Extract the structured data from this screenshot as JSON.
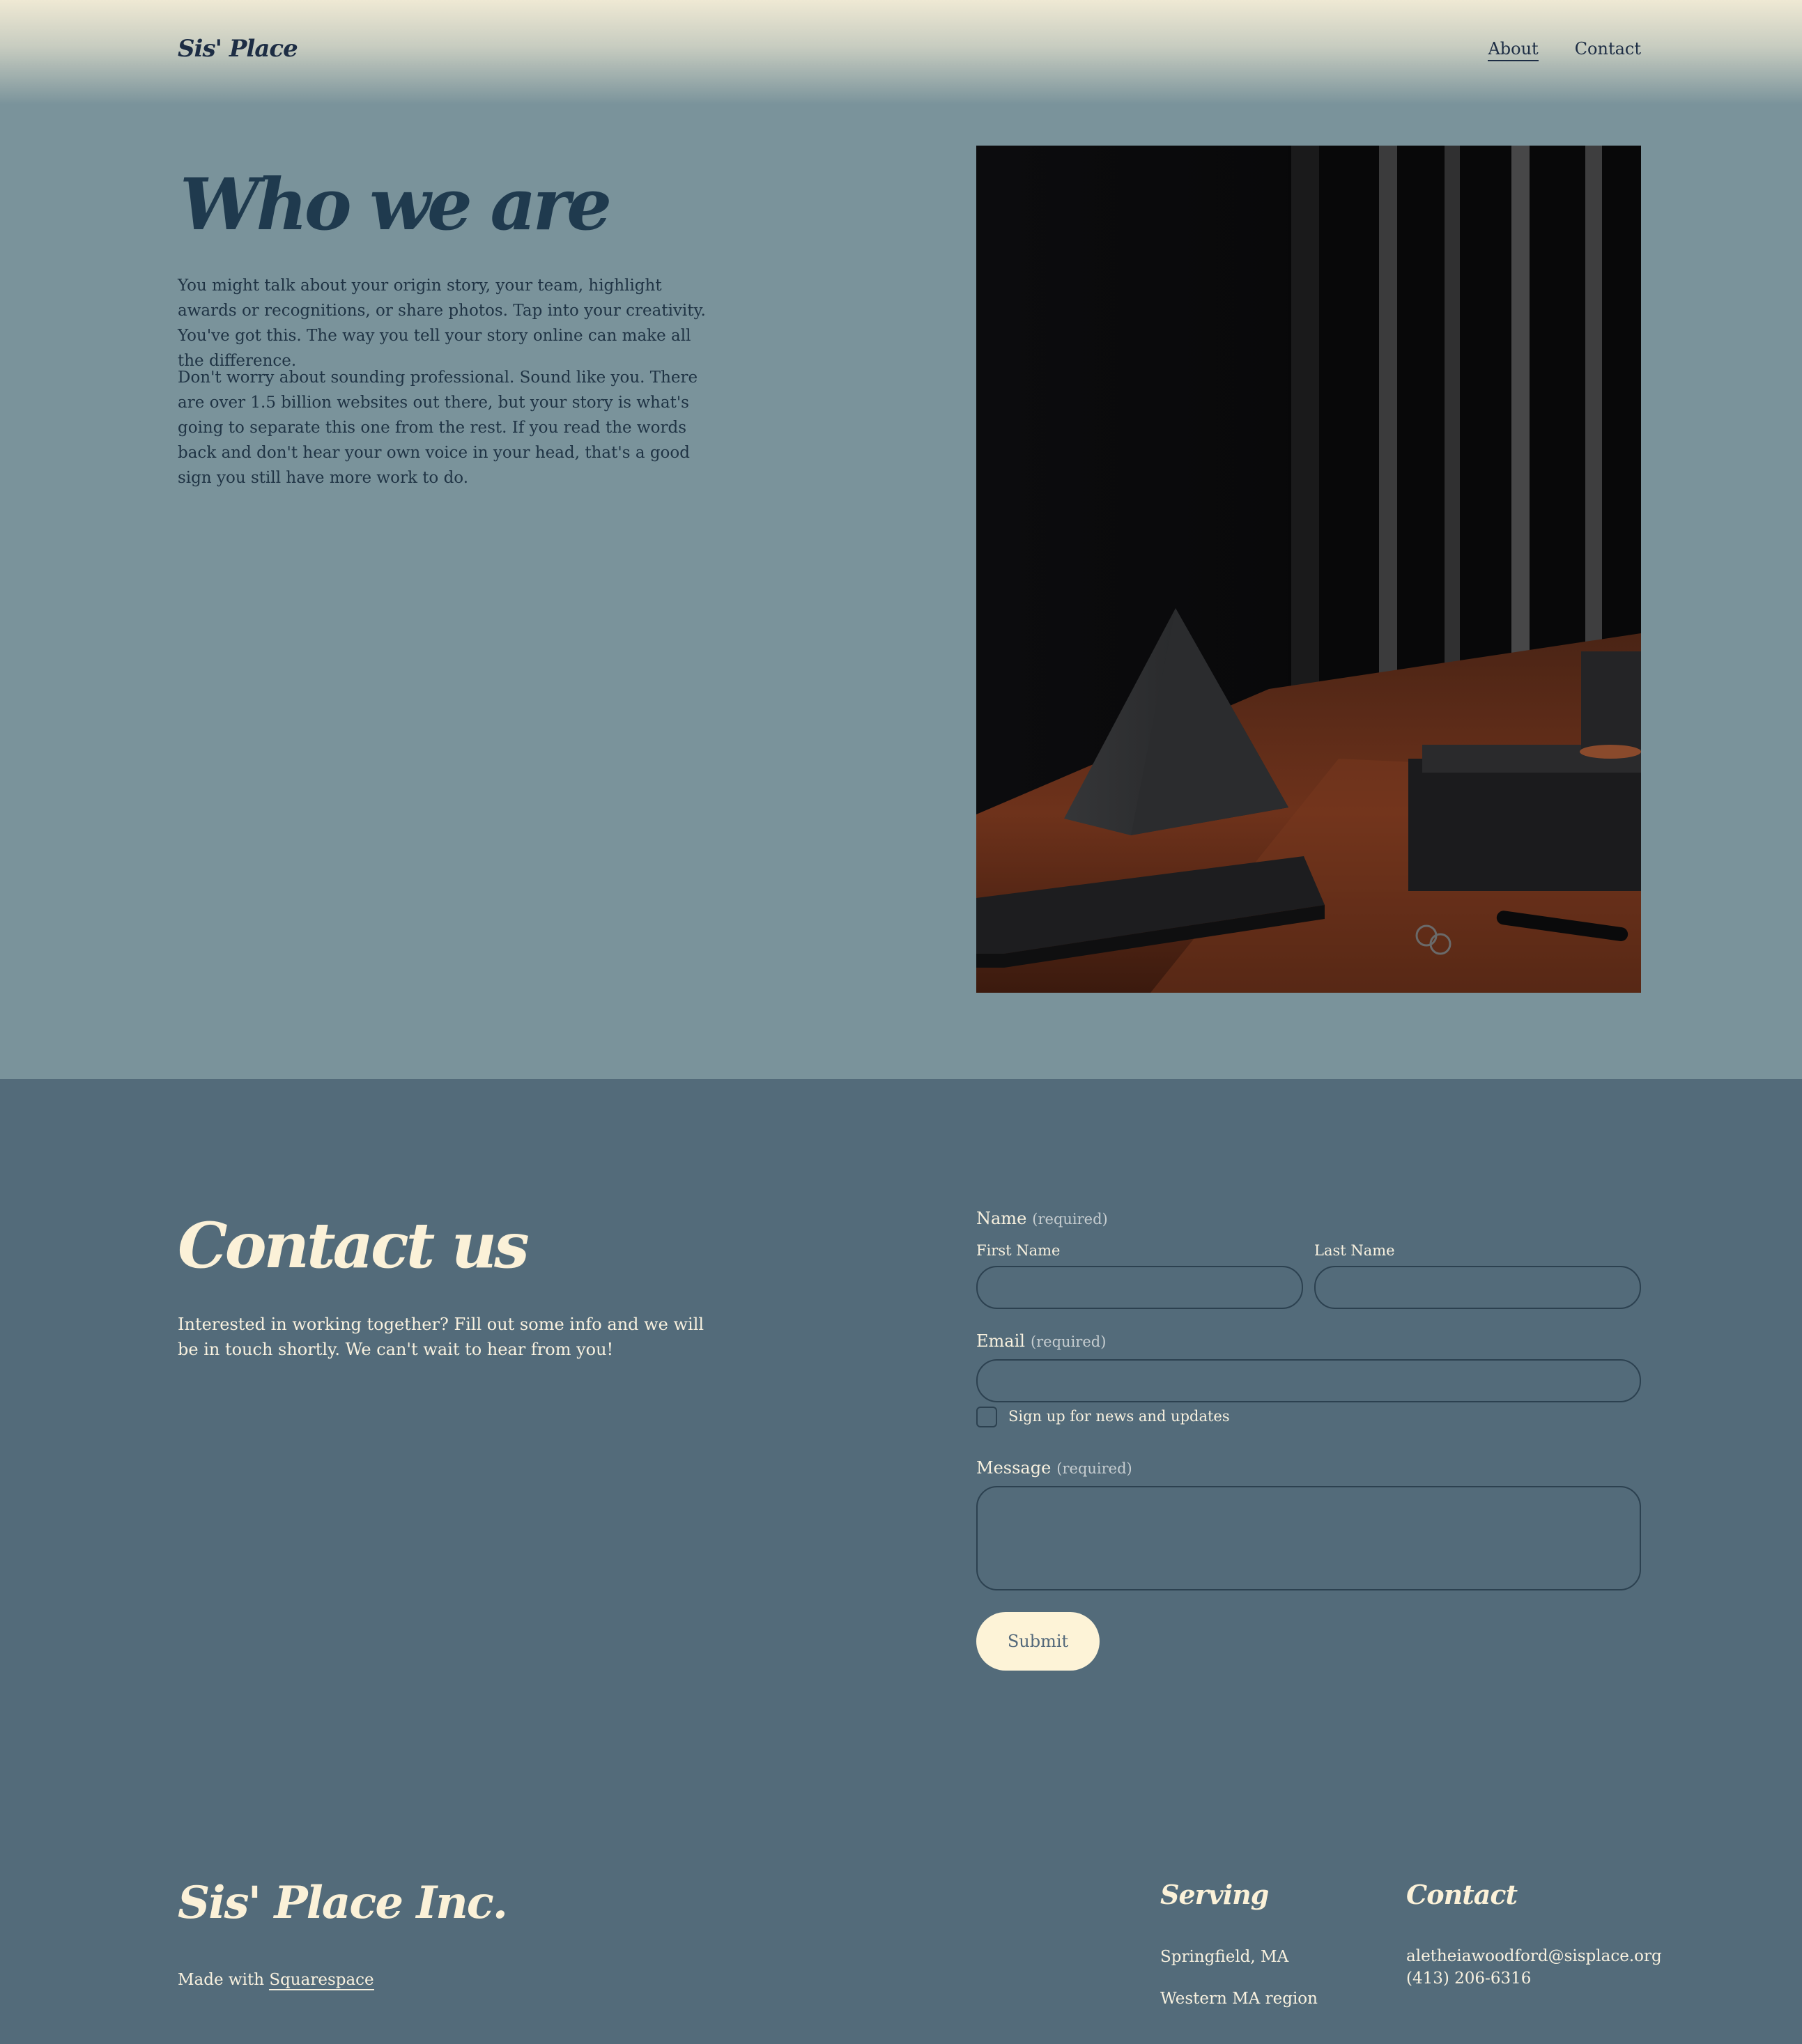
{
  "header": {
    "logo": "Sis' Place",
    "nav": [
      {
        "label": "About",
        "active": true
      },
      {
        "label": "Contact",
        "active": false
      }
    ]
  },
  "about": {
    "title": "Who we are",
    "paragraphs": [
      "You might talk about your origin story, your team, highlight awards or recognitions, or share photos. Tap into your creativity. You've got this. The way you tell your story online can make all the difference.",
      "Don't worry about sounding professional. Sound like you. There are over 1.5 billion websites out there, but your story is what's going to separate this one from the rest. If you read the words back and don't hear your own voice in your head, that's a good sign you still have more work to do."
    ]
  },
  "contact": {
    "title": "Contact us",
    "intro": "Interested in working together? Fill out some info and we will be in touch shortly. We can't wait to hear from you!",
    "form": {
      "name_label": "Name",
      "required_text": "(required)",
      "first_name_label": "First Name",
      "last_name_label": "Last Name",
      "email_label": "Email",
      "newsletter_label": "Sign up for news and updates",
      "message_label": "Message",
      "submit_label": "Submit"
    }
  },
  "footer": {
    "brand": "Sis' Place Inc.",
    "made_with_prefix": "Made with",
    "made_with_link": "Squarespace",
    "serving_heading": "Serving",
    "serving_items": [
      "Springfield, MA",
      "Western MA region"
    ],
    "contact_heading": "Contact",
    "contact_email": "aletheiawoodford@sisplace.org",
    "contact_phone": "(413) 206-6316"
  },
  "colors": {
    "about_bg": "#7a939b",
    "contact_bg": "#536b7a",
    "heading_dark": "#1f3a4e",
    "cream": "#fbf1d8"
  }
}
